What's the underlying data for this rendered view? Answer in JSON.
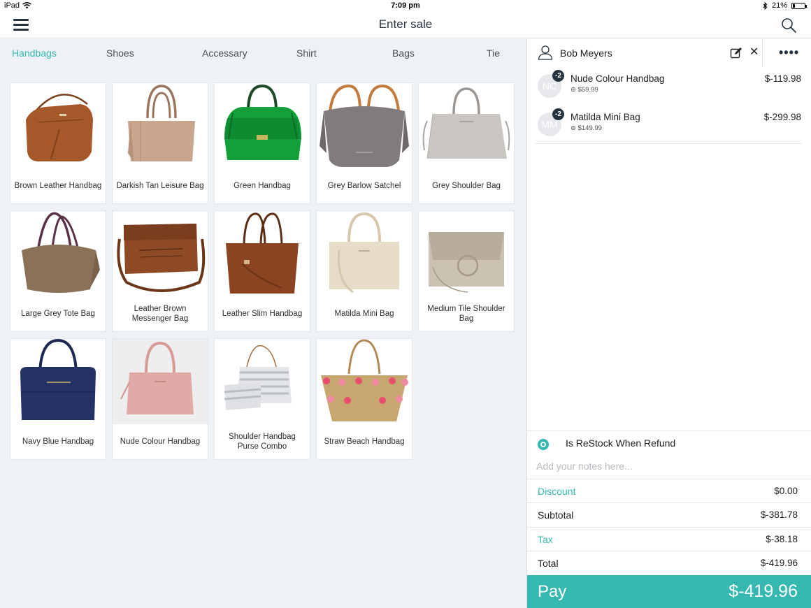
{
  "status_bar": {
    "device": "iPad",
    "time": "7:09 pm",
    "battery": "21%",
    "battery_level": 0.21
  },
  "nav": {
    "title": "Enter sale",
    "menu_icon": "hamburger-menu-icon",
    "search_icon": "search-icon"
  },
  "categories": [
    {
      "label": "Handbags",
      "active": true
    },
    {
      "label": "Shoes",
      "active": false
    },
    {
      "label": "Accessary",
      "active": false
    },
    {
      "label": "Shirt",
      "active": false
    },
    {
      "label": "Bags",
      "active": false
    },
    {
      "label": "Tie",
      "active": false
    }
  ],
  "products": [
    {
      "name": "Brown Leather Handbag"
    },
    {
      "name": "Darkish Tan Leisure Bag"
    },
    {
      "name": "Green Handbag"
    },
    {
      "name": "Grey Barlow Satchel"
    },
    {
      "name": "Grey Shoulder Bag"
    },
    {
      "name": "Large Grey Tote Bag"
    },
    {
      "name": "Leather Brown Messenger Bag"
    },
    {
      "name": "Leather Slim Handbag"
    },
    {
      "name": "Matilda Mini Bag"
    },
    {
      "name": "Medium Tile Shoulder Bag"
    },
    {
      "name": "Navy Blue Handbag"
    },
    {
      "name": "Nude Colour Handbag"
    },
    {
      "name": "Shoulder Handbag Purse Combo"
    },
    {
      "name": "Straw Beach Handbag"
    }
  ],
  "cart": {
    "customer": "Bob Meyers",
    "items": [
      {
        "initials": "NC",
        "qty": "-2",
        "name": "Nude Colour Handbag",
        "unit_price": "$59.99",
        "total": "$-119.98"
      },
      {
        "initials": "MM",
        "qty": "-2",
        "name": "Matilda Mini Bag",
        "unit_price": "$149.99",
        "total": "$-299.98"
      }
    ],
    "restock_label": "Is ReStock When Refund",
    "notes_placeholder": "Add your notes here...",
    "discount": {
      "label": "Discount",
      "value": "$0.00"
    },
    "subtotal": {
      "label": "Subtotal",
      "value": "$-381.78"
    },
    "tax": {
      "label": "Tax",
      "value": "$-38.18"
    },
    "total": {
      "label": "Total",
      "value": "$-419.96"
    },
    "pay": {
      "label": "Pay",
      "value": "$-419.96"
    }
  },
  "colors": {
    "accent": "#35b8b0",
    "navy": "#263340",
    "background": "#eef1f5"
  }
}
